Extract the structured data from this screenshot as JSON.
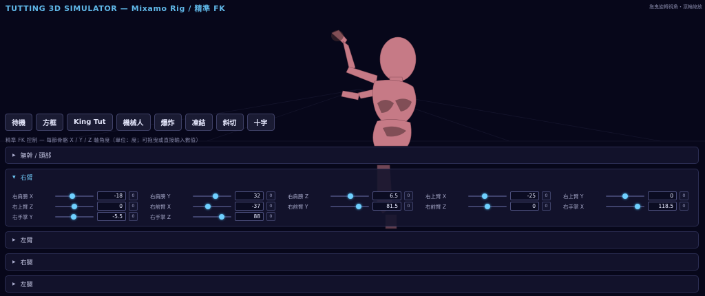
{
  "header": {
    "title": "TUTTING 3D SIMULATOR — Mixamo Rig / 精準 FK",
    "hint": "拖曳旋轉視角・滾輪縮放"
  },
  "presets": [
    "待機",
    "方框",
    "King Tut",
    "機械人",
    "爆炸",
    "凍結",
    "斜切",
    "十字"
  ],
  "fk_caption": "精準 FK 控制 — 每節骨骼 X / Y / Z 軸角度（單位：度；可拖曳或直接輸入數值）",
  "groups": {
    "torso": {
      "label": "軀幹 / 頭部"
    },
    "right_arm": {
      "label": "右臂",
      "reset_label": "0",
      "controls": [
        {
          "label": "右肩膀 X",
          "value": -18
        },
        {
          "label": "右肩膀 Y",
          "value": 32
        },
        {
          "label": "右肩膀 Z",
          "value": 6.5
        },
        {
          "label": "右上臂 X",
          "value": -25
        },
        {
          "label": "右上臂 Y",
          "value": 0
        },
        {
          "label": "右上臂 Z",
          "value": 0
        },
        {
          "label": "右前臂 X",
          "value": -37
        },
        {
          "label": "右前臂 Y",
          "value": 81.5
        },
        {
          "label": "右前臂 Z",
          "value": 0
        },
        {
          "label": "右手掌 X",
          "value": 118.5
        },
        {
          "label": "右手掌 Y",
          "value": -5.5
        },
        {
          "label": "右手掌 Z",
          "value": 88
        }
      ]
    },
    "left_arm": {
      "label": "左臂"
    },
    "right_leg": {
      "label": "右腿"
    },
    "left_leg": {
      "label": "左腿"
    }
  },
  "colors": {
    "background": "#07071a",
    "accent": "#5fb6e6",
    "figure": "#c97a86"
  },
  "slider_range": [
    -180,
    180
  ]
}
